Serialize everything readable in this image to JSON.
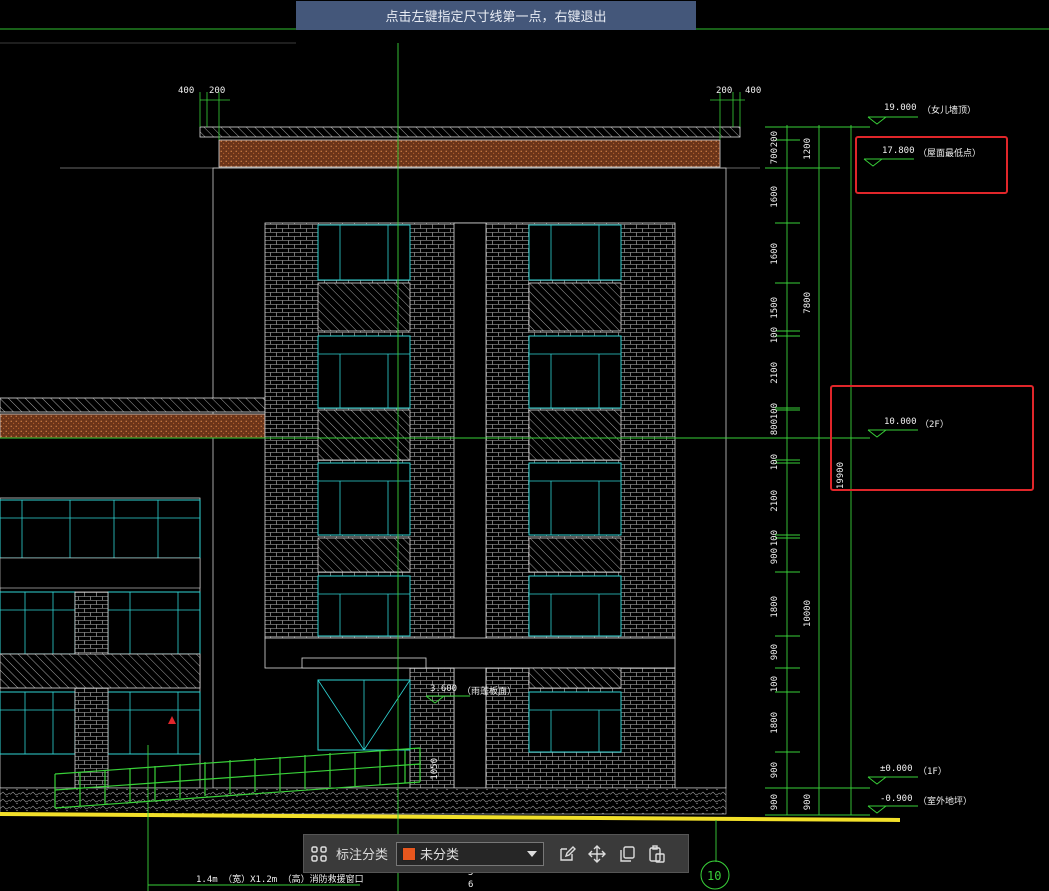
{
  "status_prompt": "点击左键指定尺寸线第一点，右键退出",
  "drawing": {
    "top_dims": [
      "400",
      "200",
      "200",
      "400"
    ],
    "right_dims_inner": [
      "200",
      "700",
      "1600",
      "1600",
      "1500",
      "100",
      "2100",
      "100",
      "800",
      "100",
      "2100",
      "100",
      "900",
      "1800",
      "900",
      "100",
      "1800",
      "900",
      "900"
    ],
    "right_dims_outer": [
      "1200",
      "7800",
      "10000",
      "900"
    ],
    "total_dim": "19900",
    "elevations": [
      {
        "value": "19.000",
        "label": "（女儿墙顶）"
      },
      {
        "value": "17.800",
        "label": "（屋面最低点）"
      },
      {
        "value": "10.000",
        "label": "（2F）"
      },
      {
        "value": "±0.000",
        "label": "（1F）"
      },
      {
        "value": "-0.900",
        "label": "（室外地坪）"
      }
    ],
    "canopy_level": {
      "value": "3.600",
      "label": "（雨蓬板面）"
    },
    "door_dim": "1050",
    "bottom_note": "1.4m （宽）X1.2m （高）消防救援窗口",
    "bottom_partial_1": "5",
    "bottom_partial_2": "6",
    "axis_label": "10"
  },
  "toolbar": {
    "category_label": "标注分类",
    "selected_category": "未分类",
    "swatch_color": "#e8571e",
    "icons": [
      "grid-icon",
      "edit-icon",
      "move-icon",
      "copy-icon",
      "paste-icon"
    ]
  },
  "highlight_color": "#e0262a"
}
